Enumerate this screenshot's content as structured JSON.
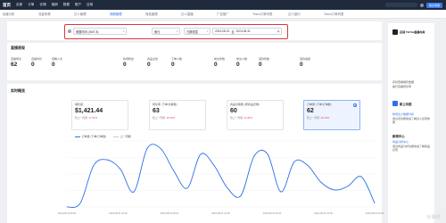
{
  "topbar": {
    "logo": "首页",
    "nav": [
      "买家",
      "订单",
      "仓储",
      "营销",
      "数据",
      "账户",
      "应用"
    ],
    "action_button": "联系客服"
  },
  "subnav": [
    "经营分析",
    "流量来源",
    "达人管理",
    "视频管理",
    "商品管理",
    "达人直播",
    "广告推广",
    "Tesco订单列表",
    "达人邀约",
    "Tesco订单列表"
  ],
  "filters": {
    "timezone": "美国时间 (GMT-8)",
    "currency": "美元",
    "date_mode": "日期范围",
    "date_start": "2024-08-31",
    "date_sep": "至",
    "date_end": "2024-08-31"
  },
  "overview": {
    "title": "直播表现",
    "metrics": [
      {
        "label": "直播场次",
        "value": "62"
      },
      {
        "label": "直播时长",
        "value": "0"
      },
      {
        "label": "观看人次",
        "value": "0"
      },
      {
        "label": "新增粉丝",
        "value": "0"
      },
      {
        "label": "商品点击",
        "value": "0"
      },
      {
        "label": "下单人数",
        "value": "0"
      },
      {
        "label": "成交件数",
        "value": "0"
      },
      {
        "label": "成交人数",
        "value": "0"
      },
      {
        "label": "退款件数",
        "value": "0"
      },
      {
        "label": "退款金额",
        "value": "0"
      }
    ]
  },
  "realtime": {
    "title": "实时概览",
    "kpis": [
      {
        "label": "销售额",
        "value": "$1,421.44",
        "cmp_prefix": "较上一周期",
        "cmp_value": "-27.51%"
      },
      {
        "label": "转化率 (下单/访客数)",
        "value": "63",
        "cmp_prefix": "较上一周期",
        "cmp_value": "-25.23%"
      },
      {
        "label": "商品访客数 (按商品去重)",
        "value": "60",
        "cmp_prefix": "较上一周期",
        "cmp_value": "-31.82%"
      },
      {
        "label": "订单量 (下单/订单数)",
        "value": "62",
        "cmp_prefix": "较上一周期",
        "cmp_value": "-26.19%"
      }
    ],
    "legend": [
      "订单量 (下单/订单数)",
      "上一周期"
    ],
    "colors": {
      "current": "#2f6fe8",
      "previous": "#c3cad4",
      "decrease": "#e5484d",
      "highlight": "#d9363e"
    }
  },
  "chart_data": {
    "type": "line",
    "x": [
      "2024-08-31 00:00",
      "2024-08-31 04:00",
      "2024-08-31 08:00",
      "2024-08-31 12:00",
      "2024-08-31 16:00",
      "2024-08-31 20:00",
      "2024-08-31 23:00"
    ],
    "series": [
      {
        "name": "订单量 (下单/订单数)",
        "values": [
          0,
          0.2,
          2.2,
          2.5,
          2.0,
          0.8,
          3.1,
          3.1,
          1.9,
          1.0,
          2.8,
          2.2,
          1.0,
          0.6,
          2.7,
          2.8,
          0.8,
          2.4,
          2.2,
          1.3,
          0.9,
          1.1,
          1.6,
          0.2
        ]
      },
      {
        "name": "上一周期",
        "values": []
      }
    ],
    "ylim": [
      0,
      3.5
    ]
  },
  "sidebar": {
    "promo_title": "店铺 TikTok直播电商",
    "promo_lines": [
      "实时查看销售数据",
      "提升直播转化率"
    ],
    "section1_title": "新上功能",
    "section1_items": [
      "新增达人数据分析",
      "通过该功能快速了解达人表现效果"
    ],
    "section2_title": "新增中心",
    "section2_items": [
      "商品分析中心",
      "通过商品分析功能快速了解商品表现"
    ]
  },
  "watermark": "© 知乎"
}
